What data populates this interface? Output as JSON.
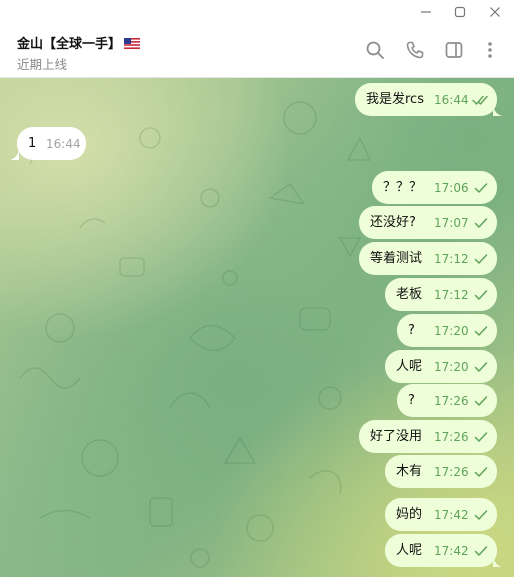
{
  "window": {
    "controls": [
      "minimize-icon",
      "maximize-icon",
      "close-icon"
    ]
  },
  "header": {
    "title": "金山【全球一手】",
    "flag_icon": "us-flag-icon",
    "status": "近期上线",
    "actions": [
      "search-icon",
      "phone-icon",
      "sidebar-toggle-icon",
      "more-vertical-icon"
    ]
  },
  "colors": {
    "outgoing_bubble": "#eefed9",
    "incoming_bubble": "#ffffff",
    "outgoing_meta": "#5fa35a",
    "incoming_meta": "#a3a3a3"
  },
  "messages": [
    {
      "direction": "out",
      "text": "我是发rcs",
      "time": "16:44",
      "status": "read-double-check"
    },
    {
      "direction": "in",
      "text": "1",
      "time": "16:44"
    },
    {
      "direction": "out",
      "text": "？？？",
      "time": "17:06",
      "status": "sent-check"
    },
    {
      "direction": "out",
      "text": "还没好?",
      "time": "17:07",
      "status": "sent-check"
    },
    {
      "direction": "out",
      "text": "等着测试",
      "time": "17:12",
      "status": "sent-check"
    },
    {
      "direction": "out",
      "text": "老板",
      "time": "17:12",
      "status": "sent-check"
    },
    {
      "direction": "out",
      "text": "?",
      "time": "17:20",
      "status": "sent-check"
    },
    {
      "direction": "out",
      "text": "人呢",
      "time": "17:20",
      "status": "sent-check"
    },
    {
      "direction": "out",
      "text": "?",
      "time": "17:26",
      "status": "sent-check"
    },
    {
      "direction": "out",
      "text": "好了没用",
      "time": "17:26",
      "status": "sent-check"
    },
    {
      "direction": "out",
      "text": "木有",
      "time": "17:26",
      "status": "sent-check"
    },
    {
      "direction": "out",
      "text": "妈的",
      "time": "17:42",
      "status": "sent-check"
    },
    {
      "direction": "out",
      "text": "人呢",
      "time": "17:42",
      "status": "sent-check"
    }
  ]
}
